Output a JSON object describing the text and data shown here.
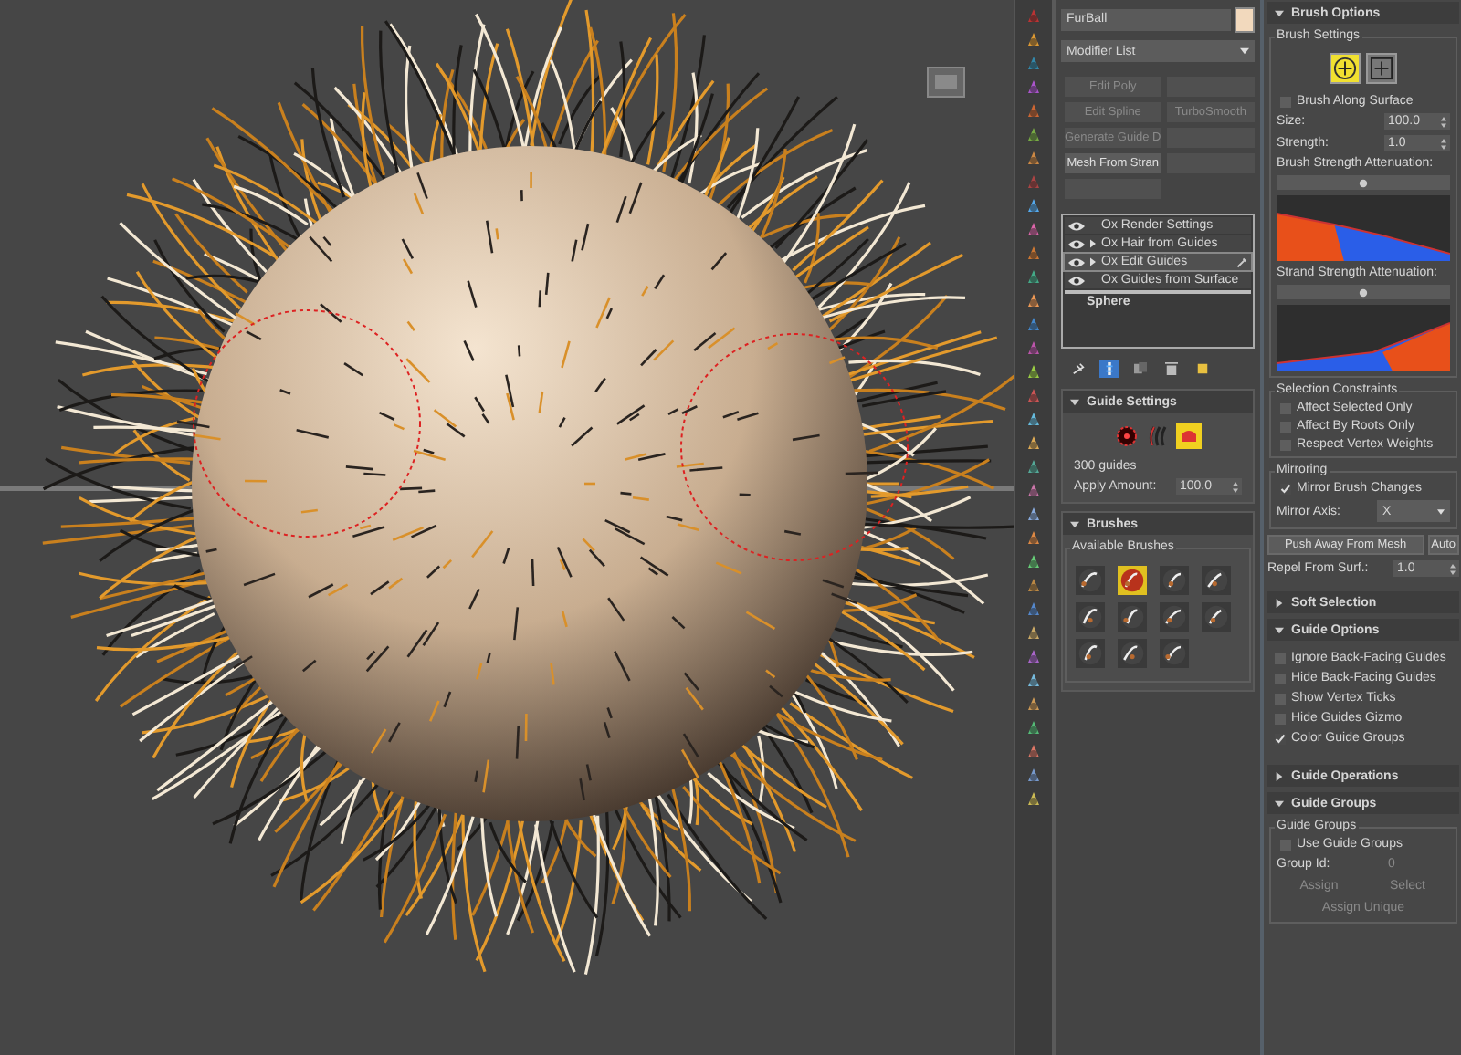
{
  "object": {
    "name": "FurBall",
    "color": "#f2d9bd"
  },
  "modifier_list": {
    "label": "Modifier List"
  },
  "modifier_buttons": [
    {
      "kind": "label",
      "label": "Edit Poly",
      "disabled": true
    },
    {
      "kind": "blank",
      "disabled": true
    },
    {
      "kind": "label",
      "label": "Edit Spline",
      "disabled": true
    },
    {
      "kind": "label",
      "label": "TurboSmooth",
      "disabled": true
    },
    {
      "kind": "label",
      "label": "Generate Guide D",
      "disabled": true
    },
    {
      "kind": "blank",
      "disabled": true
    },
    {
      "kind": "label",
      "label": "Mesh From Stran",
      "disabled": false
    },
    {
      "kind": "blank",
      "disabled": true
    },
    {
      "kind": "blank",
      "disabled": true
    }
  ],
  "stack": [
    {
      "label": "Ox Render Settings",
      "expandable": false,
      "selected": false
    },
    {
      "label": "Ox Hair from Guides",
      "expandable": true,
      "selected": false
    },
    {
      "label": "Ox Edit Guides",
      "expandable": true,
      "selected": true
    },
    {
      "label": "Ox Guides from Surface",
      "expandable": false,
      "selected": false
    }
  ],
  "base_object": "Sphere",
  "stack_tools": [
    {
      "kind": "pin",
      "selected": false
    },
    {
      "kind": "stack",
      "selected": true
    },
    {
      "kind": "unique",
      "selected": false
    },
    {
      "kind": "trash",
      "selected": false
    },
    {
      "kind": "configure",
      "selected": false
    }
  ],
  "guide_settings": {
    "title": "Guide Settings",
    "expanded": true,
    "modes": [
      {
        "kind": "dot",
        "selected": false
      },
      {
        "kind": "strands",
        "selected": false
      },
      {
        "kind": "comb",
        "selected": true
      }
    ],
    "count": "300 guides",
    "apply_label": "Apply Amount:",
    "apply_value": "100.0"
  },
  "brushes": {
    "title": "Brushes",
    "expanded": true,
    "group": "Available Brushes",
    "items": [
      {
        "selected": false
      },
      {
        "selected": true
      },
      {
        "selected": false
      },
      {
        "selected": false
      },
      {
        "selected": false
      },
      {
        "selected": false
      },
      {
        "selected": false
      },
      {
        "selected": false
      },
      {
        "selected": false
      },
      {
        "selected": false
      },
      {
        "selected": false
      }
    ]
  },
  "brush_options": {
    "title": "Brush Options",
    "expanded": true,
    "group": "Brush Settings",
    "modes": [
      {
        "kind": "circle",
        "selected": true
      },
      {
        "kind": "square",
        "selected": false
      }
    ],
    "along_surface": {
      "label": "Brush Along Surface",
      "checked": false
    },
    "size_label": "Size:",
    "size": "100.0",
    "strength_label": "Strength:",
    "strength": "1.0",
    "brush_atten": "Brush Strength Attenuation:",
    "strand_atten": "Strand Strength Attenuation:"
  },
  "selection_constraints": {
    "title": "Selection Constraints",
    "options": [
      {
        "label": "Affect Selected Only",
        "checked": false
      },
      {
        "label": "Affect By Roots Only",
        "checked": false
      },
      {
        "label": "Respect Vertex Weights",
        "checked": false
      }
    ]
  },
  "mirroring": {
    "title": "Mirroring",
    "mirror": {
      "label": "Mirror Brush Changes",
      "checked": true
    },
    "axis_label": "Mirror Axis:",
    "axis": "X"
  },
  "push_button": "Push Away From Mesh",
  "auto_button": "Auto",
  "repel_label": "Repel From Surf.:",
  "repel": "1.0",
  "soft_selection": {
    "title": "Soft Selection",
    "expanded": false
  },
  "guide_options": {
    "title": "Guide Options",
    "expanded": true,
    "options": [
      {
        "label": "Ignore Back-Facing Guides",
        "checked": false
      },
      {
        "label": "Hide Back-Facing Guides",
        "checked": false
      },
      {
        "label": "Show Vertex Ticks",
        "checked": false
      },
      {
        "label": "Hide Guides Gizmo",
        "checked": false
      },
      {
        "label": "Color Guide Groups",
        "checked": true
      }
    ]
  },
  "guide_operations": {
    "title": "Guide Operations",
    "expanded": false
  },
  "guide_groups": {
    "title": "Guide Groups",
    "expanded": true,
    "group": "Guide Groups",
    "use": {
      "label": "Use Guide Groups",
      "checked": false
    },
    "id_label": "Group Id:",
    "id": "0",
    "assign": "Assign",
    "select": "Select",
    "assign_unique": "Assign Unique"
  }
}
